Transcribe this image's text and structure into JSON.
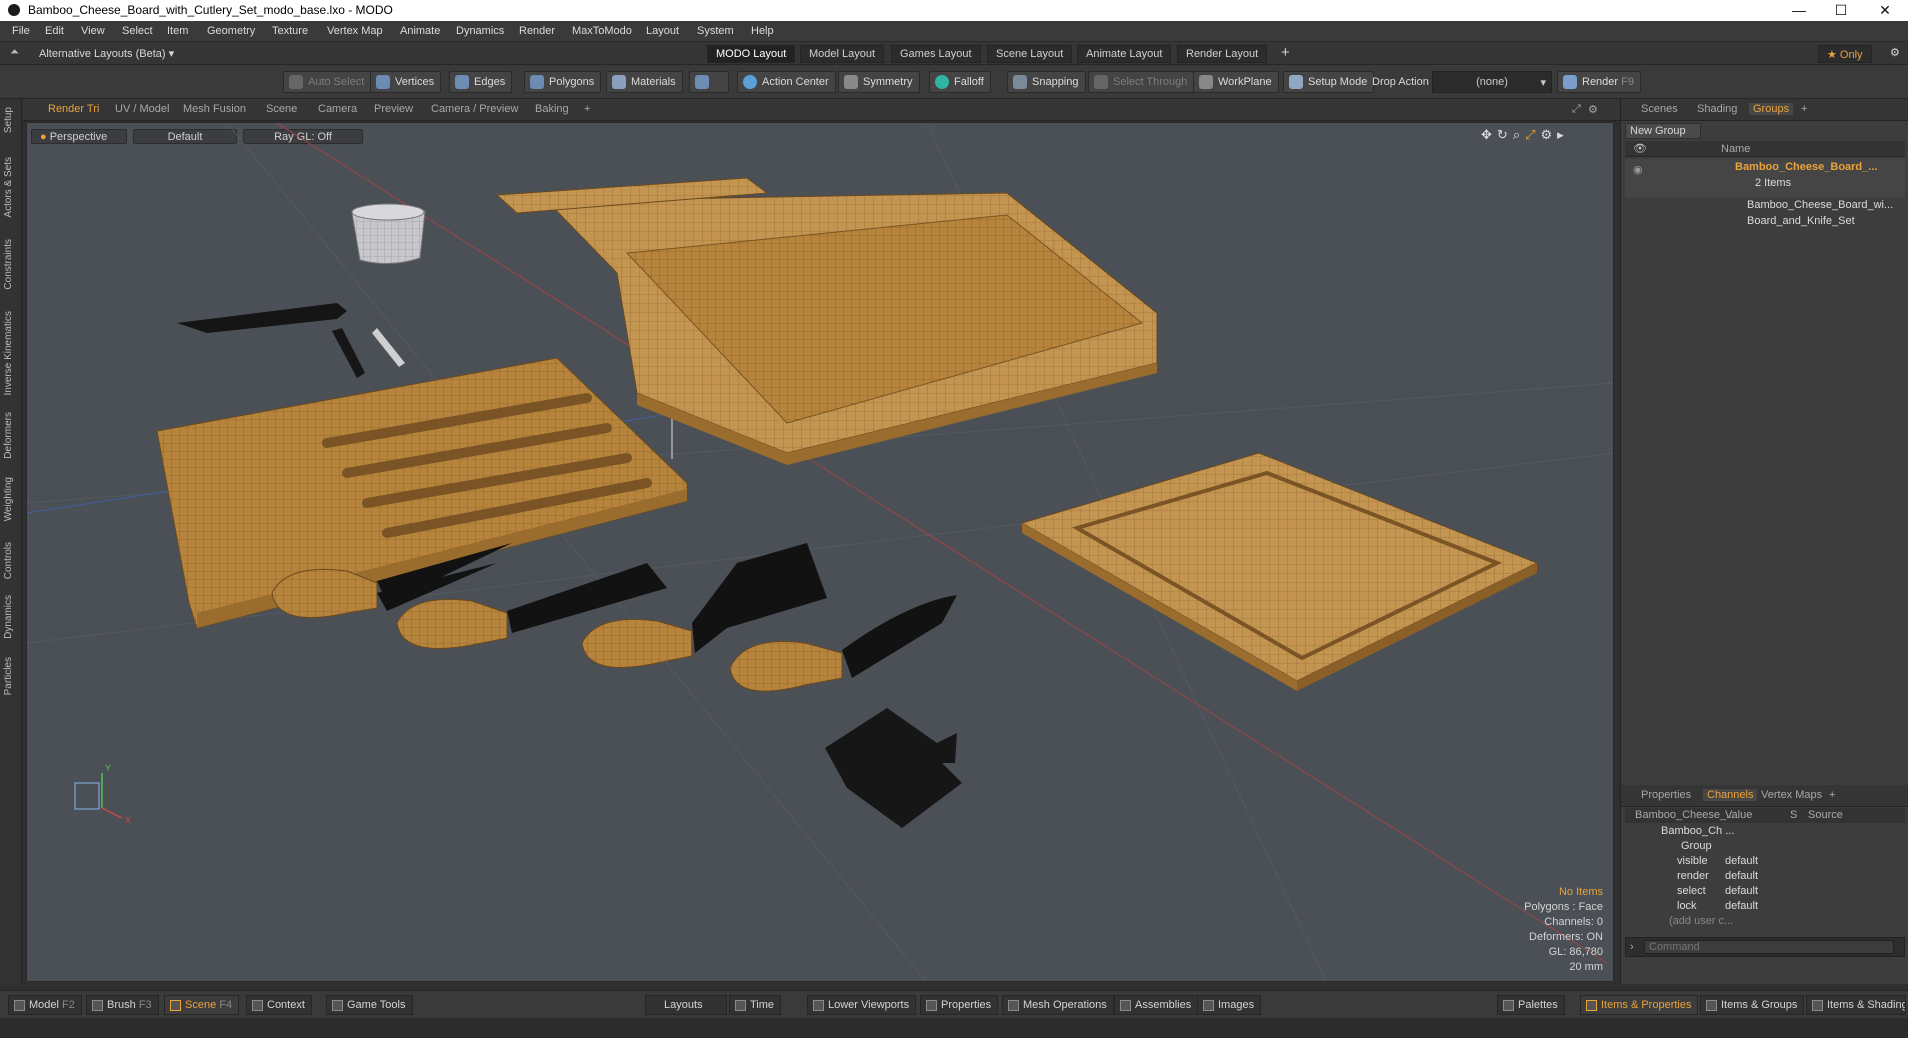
{
  "window": {
    "title": "Bamboo_Cheese_Board_with_Cutlery_Set_modo_base.lxo - MODO",
    "minimize": "—",
    "maximize": "☐",
    "close": "✕"
  },
  "menu": [
    "File",
    "Edit",
    "View",
    "Select",
    "Item",
    "Geometry",
    "Texture",
    "Vertex Map",
    "Animate",
    "Dynamics",
    "Render",
    "MaxToModo",
    "Layout",
    "System",
    "Help"
  ],
  "layouts": {
    "dropdown": "Alternative Layouts (Beta) ▾",
    "tabs": [
      "MODO Layout",
      "Model Layout",
      "Games Layout",
      "Scene Layout",
      "Animate Layout",
      "Render Layout"
    ],
    "add": "+",
    "only": "★ Only"
  },
  "toolbar": {
    "auto_select": "Auto Select",
    "vertices": "Vertices",
    "edges": "Edges",
    "polygons": "Polygons",
    "materials": "Materials",
    "action_center": "Action Center",
    "symmetry": "Symmetry",
    "falloff": "Falloff",
    "snapping": "Snapping",
    "select_through": "Select Through",
    "workplane": "WorkPlane",
    "setup_mode": "Setup Mode",
    "drop_action": "Drop Action",
    "drop_value": "(none)",
    "render": "Render",
    "render_key": "F9"
  },
  "left_tabs": [
    "Setup",
    "Actors & Sets",
    "Constraints",
    "Inverse Kinematics",
    "Deformers",
    "Weighting",
    "Controls",
    "Dynamics",
    "Particles"
  ],
  "viewport_tabs": [
    "Render Tri",
    "UV / Model",
    "Mesh Fusion",
    "Scene",
    "Camera",
    "Preview",
    "Camera / Preview",
    "Baking",
    "+"
  ],
  "viewport": {
    "view": "Perspective",
    "shading": "Default",
    "raygl": "Ray GL: Off"
  },
  "stats": {
    "items": "No Items",
    "polygons": "Polygons : Face",
    "channels": "Channels: 0",
    "deformers": "Deformers: ON",
    "gl": "GL: 86,780",
    "scale": "20 mm"
  },
  "axis": {
    "y": "Y",
    "x": "X"
  },
  "right_tabs": [
    "Scenes",
    "Shading",
    "Groups",
    "+"
  ],
  "groups": {
    "new_group": "New Group",
    "name_header": "Name",
    "root": "Bamboo_Cheese_Board_...",
    "count": "2 Items",
    "children": [
      "Bamboo_Cheese_Board_wi...",
      "Board_and_Knife_Set"
    ]
  },
  "props_tabs": [
    "Properties",
    "Channels",
    "Vertex Maps",
    "+"
  ],
  "channels": {
    "col_name": "Bamboo_Cheese_...",
    "col_value": "Value",
    "col_s": "S",
    "col_source": "Source",
    "item": "Bamboo_Ch ...",
    "group": "Group",
    "rows": [
      {
        "name": "visible",
        "value": "default"
      },
      {
        "name": "render",
        "value": "default"
      },
      {
        "name": "select",
        "value": "default"
      },
      {
        "name": "lock",
        "value": "default"
      }
    ],
    "add": "(add user c..."
  },
  "command_placeholder": "Command",
  "statusbar": {
    "model": "Model",
    "model_key": "F2",
    "brush": "Brush",
    "brush_key": "F3",
    "scene": "Scene",
    "scene_key": "F4",
    "context": "Context",
    "game_tools": "Game Tools",
    "layouts": "Layouts",
    "time": "Time",
    "lower_viewports": "Lower Viewports",
    "properties": "Properties",
    "mesh_operations": "Mesh Operations",
    "assemblies": "Assemblies",
    "images": "Images",
    "palettes": "Palettes",
    "items_properties": "Items & Properties",
    "items_groups": "Items & Groups",
    "items_shading": "Items & Shading"
  },
  "colors": {
    "accent": "#e9a33a",
    "viewport_bg": "#4b4f56",
    "wood": "#b7873f",
    "blade": "#111111"
  }
}
